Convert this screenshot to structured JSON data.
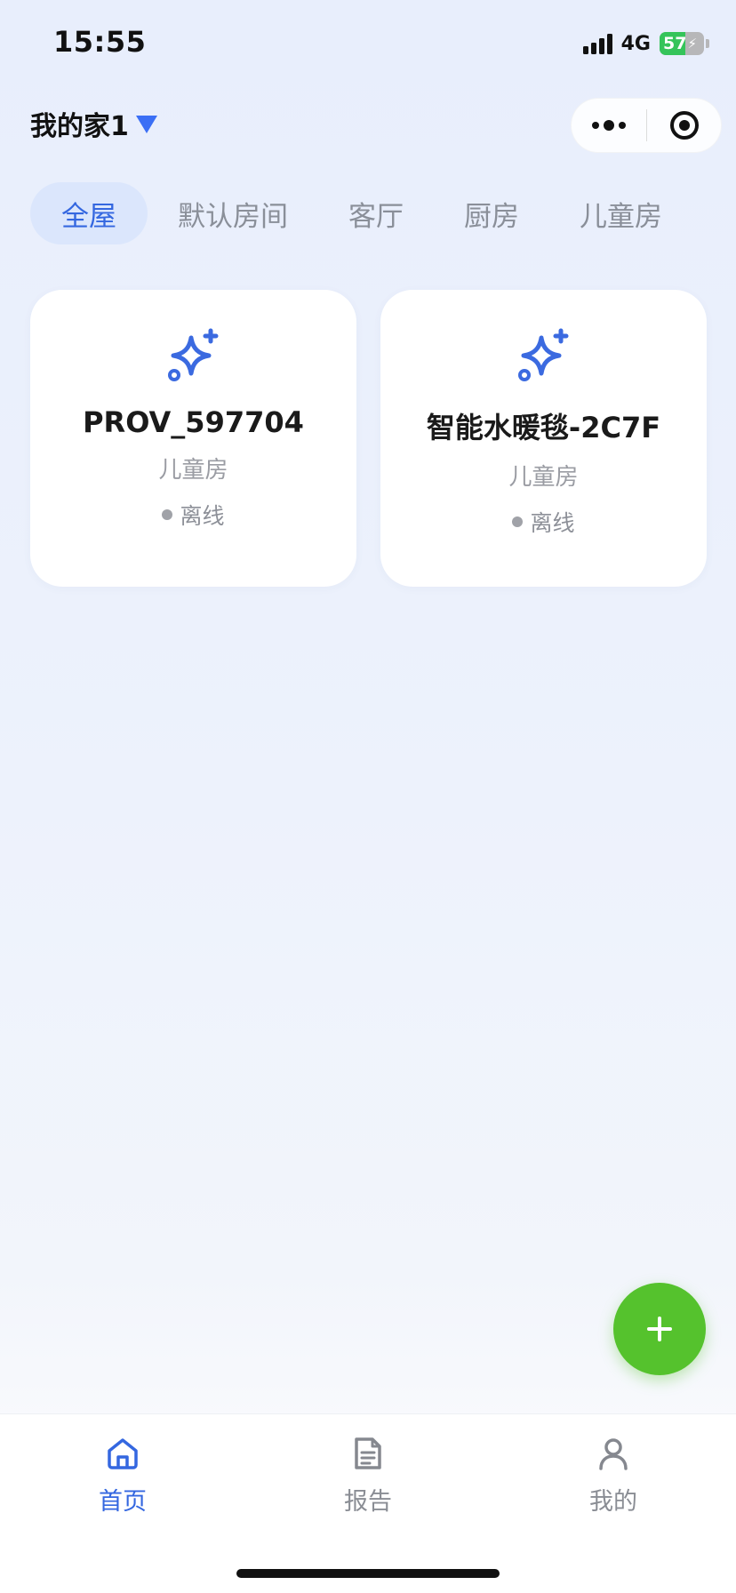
{
  "status_bar": {
    "time": "15:55",
    "network": "4G",
    "battery": "57"
  },
  "header": {
    "home_name": "我的家1"
  },
  "tabs": [
    {
      "label": "全屋",
      "active": true
    },
    {
      "label": "默认房间",
      "active": false
    },
    {
      "label": "客厅",
      "active": false
    },
    {
      "label": "厨房",
      "active": false
    },
    {
      "label": "儿童房",
      "active": false
    }
  ],
  "devices": [
    {
      "name": "PROV_597704",
      "room": "儿童房",
      "status": "离线",
      "icon": "sparkle-icon"
    },
    {
      "name": "智能水暖毯-2C7F",
      "room": "儿童房",
      "status": "离线",
      "icon": "sparkle-icon"
    }
  ],
  "bottom_nav": [
    {
      "label": "首页",
      "icon": "home-icon",
      "active": true
    },
    {
      "label": "报告",
      "icon": "document-icon",
      "active": false
    },
    {
      "label": "我的",
      "icon": "user-icon",
      "active": false
    }
  ],
  "colors": {
    "accent": "#3467e0",
    "fab": "#55c22d",
    "active_tab_bg": "#dbe6fc",
    "battery": "#35c45a"
  }
}
